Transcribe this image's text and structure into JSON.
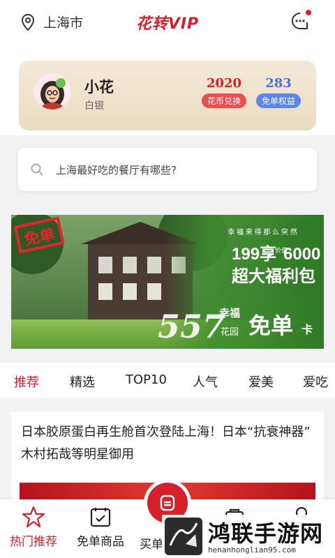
{
  "header": {
    "location": "上海市",
    "brand": "花转VIP"
  },
  "user": {
    "name": "小花",
    "level": "白银",
    "coins": {
      "value": "2020",
      "label": "花币兑换",
      "color": "#d4202b"
    },
    "free": {
      "value": "283",
      "label": "免单权益",
      "color": "#4a6fd8"
    }
  },
  "search": {
    "placeholder": "上海最好吃的餐厅有哪些?"
  },
  "banner": {
    "badge": "免单",
    "slogan": "幸 福 来 得 那 么 突 然",
    "offer_prefix": "199享",
    "offer_value_label": "价值",
    "offer_value": "6000",
    "offer_sub": "超大福利包",
    "card_num": "557",
    "card_tag1": "幸福",
    "card_tag2": "花园",
    "card_name": "免单",
    "card_suffix": "卡"
  },
  "tabs": [
    "推荐",
    "精选",
    "TOP10",
    "人气",
    "爱美",
    "爱吃"
  ],
  "article": {
    "title": "日本胶原蛋白再生舱首次登陆上海！日本“抗衰神器” 木村拓哉等明星御用"
  },
  "bottom_nav": [
    {
      "label": "热门推荐",
      "icon": "star-icon"
    },
    {
      "label": "免单商品",
      "icon": "checklist-icon"
    },
    {
      "label": "买单",
      "icon": "pay-icon"
    },
    {
      "label": "",
      "icon": "cart-icon"
    },
    {
      "label": "",
      "icon": "user-icon"
    }
  ],
  "watermark": {
    "text": "鸿联手游网",
    "url": "henanhonglian95.com"
  }
}
